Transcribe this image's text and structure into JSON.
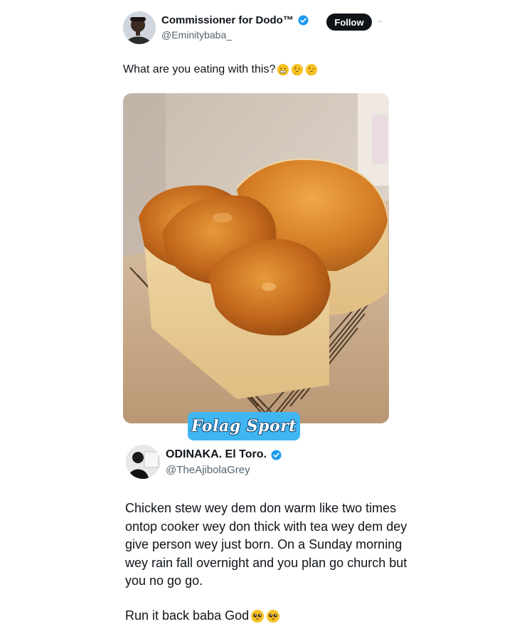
{
  "tweet": {
    "author_name": "Commissioner for Dodo™",
    "author_handle": "@Eminitybaba_",
    "follow_label": "Follow",
    "more_dash": "–",
    "text": "What are you eating with this?",
    "emojis": [
      "grimacing-face",
      "thinking-face",
      "thinking-face"
    ],
    "photo_description_icon": "bread-loaves-photo"
  },
  "watermark": {
    "text": "Folag Sport"
  },
  "reply": {
    "author_name": "ODINAKA. El Toro.",
    "author_handle": "@TheAjibolaGrey",
    "paragraph1": "Chicken stew wey dem don warm like two times ontop cooker wey don thick with tea wey dem dey give person wey just born. On a Sunday morning wey rain fall overnight and you plan go church but you no go go.",
    "paragraph2": "Run it back baba God",
    "paragraph2_emojis": [
      "pleading-face",
      "pleading-face"
    ]
  },
  "colors": {
    "verified": "#1d9bf0",
    "follow_bg": "#0f1419",
    "handle": "#536471",
    "watermark_bg": "#3fb6f2"
  }
}
